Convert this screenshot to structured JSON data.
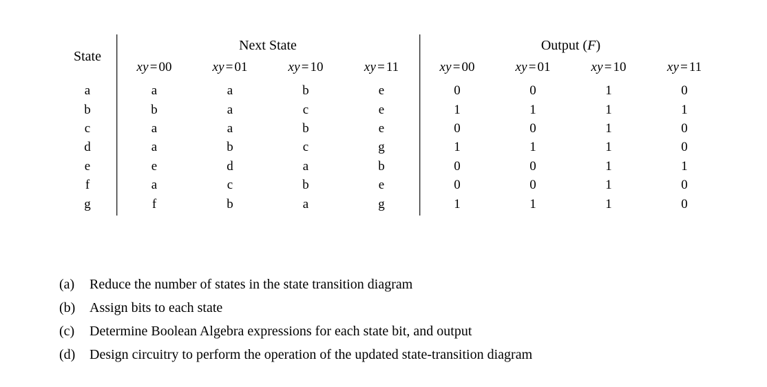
{
  "document": {
    "type": "state-transition-table-problem"
  },
  "table": {
    "state_header": "State",
    "group_headers": [
      {
        "id": "next-state",
        "label": "Next State",
        "colspan": 4
      },
      {
        "id": "output",
        "label_prefix": "Output (",
        "label_var": "F",
        "label_suffix": ")",
        "label": "Output (F)",
        "colspan": 4
      }
    ],
    "condition_var": "xy",
    "condition_operator": "=",
    "sub_headers": [
      "00",
      "01",
      "10",
      "11"
    ],
    "sub_header_labels": [
      "xy = 00",
      "xy = 01",
      "xy = 10",
      "xy = 11",
      "xy = 00",
      "xy = 01",
      "xy = 10",
      "xy = 11"
    ],
    "rows": [
      {
        "state": "a",
        "next": [
          "a",
          "a",
          "b",
          "e"
        ],
        "output": [
          "0",
          "0",
          "1",
          "0"
        ]
      },
      {
        "state": "b",
        "next": [
          "b",
          "a",
          "c",
          "e"
        ],
        "output": [
          "1",
          "1",
          "1",
          "1"
        ]
      },
      {
        "state": "c",
        "next": [
          "a",
          "a",
          "b",
          "e"
        ],
        "output": [
          "0",
          "0",
          "1",
          "0"
        ]
      },
      {
        "state": "d",
        "next": [
          "a",
          "b",
          "c",
          "g"
        ],
        "output": [
          "1",
          "1",
          "1",
          "0"
        ]
      },
      {
        "state": "e",
        "next": [
          "e",
          "d",
          "a",
          "b"
        ],
        "output": [
          "0",
          "0",
          "1",
          "1"
        ]
      },
      {
        "state": "f",
        "next": [
          "a",
          "c",
          "b",
          "e"
        ],
        "output": [
          "0",
          "0",
          "1",
          "0"
        ]
      },
      {
        "state": "g",
        "next": [
          "f",
          "b",
          "a",
          "g"
        ],
        "output": [
          "1",
          "1",
          "1",
          "0"
        ]
      }
    ]
  },
  "questions": [
    {
      "label": "(a)",
      "text": "Reduce the number of states in the state transition diagram"
    },
    {
      "label": "(b)",
      "text": "Assign bits to each state"
    },
    {
      "label": "(c)",
      "text": "Determine Boolean Algebra expressions for each state bit, and output"
    },
    {
      "label": "(d)",
      "text": "Design circuitry to perform the operation of the updated state-transition diagram"
    }
  ],
  "colors": {
    "text": "#000000",
    "rule": "#2b2b2b",
    "background": "#ffffff"
  }
}
